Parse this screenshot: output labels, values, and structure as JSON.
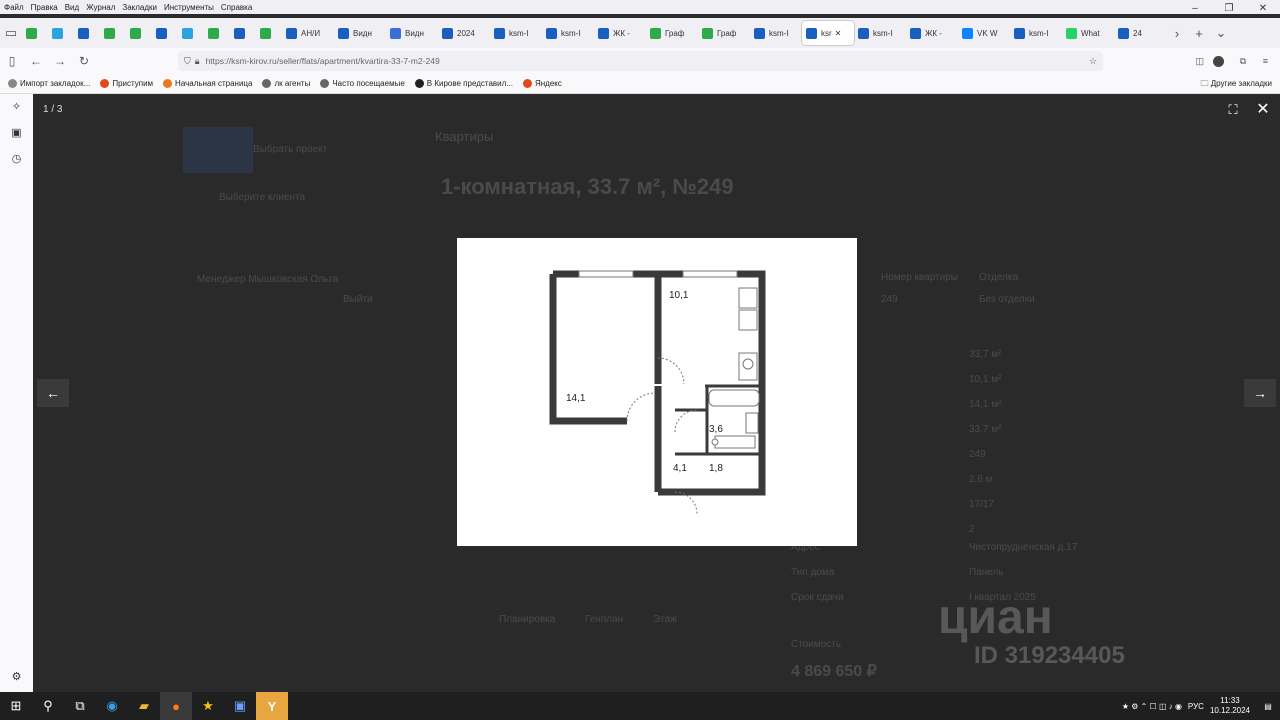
{
  "menu": [
    "Файл",
    "Правка",
    "Вид",
    "Журнал",
    "Закладки",
    "Инструменты",
    "Справка"
  ],
  "tabs": [
    {
      "label": "",
      "color": "#2eaa4a"
    },
    {
      "label": "",
      "color": "#2aa3e0"
    },
    {
      "label": "",
      "color": "#1a5fbf"
    },
    {
      "label": "",
      "color": "#2eaa4a"
    },
    {
      "label": "",
      "color": "#2eaa4a"
    },
    {
      "label": "",
      "color": "#1a5fbf"
    },
    {
      "label": "",
      "color": "#2aa3e0"
    },
    {
      "label": "",
      "color": "#2eaa4a"
    },
    {
      "label": "",
      "color": "#1a5fbf"
    },
    {
      "label": "",
      "color": "#2eaa4a"
    },
    {
      "label": "АН/И",
      "color": "#1a5fbf"
    },
    {
      "label": "Видн",
      "color": "#1a5fbf"
    },
    {
      "label": "Видн",
      "color": "#3b6fd6"
    },
    {
      "label": "2024",
      "color": "#1a5fbf"
    },
    {
      "label": "ksm-I",
      "color": "#1a5fbf"
    },
    {
      "label": "ksm-I",
      "color": "#1a5fbf"
    },
    {
      "label": "ЖК -",
      "color": "#1a5fbf"
    },
    {
      "label": "Граф",
      "color": "#2eaa4a"
    },
    {
      "label": "Граф",
      "color": "#2eaa4a"
    },
    {
      "label": "ksm-I",
      "color": "#1a5fbf"
    },
    {
      "label": "ksr",
      "color": "#1a5fbf",
      "active": true
    },
    {
      "label": "ksm-I",
      "color": "#1a5fbf"
    },
    {
      "label": "ЖК -",
      "color": "#1a5fbf"
    },
    {
      "label": "VK W",
      "color": "#0a84ff"
    },
    {
      "label": "ksm-I",
      "color": "#1a5fbf"
    },
    {
      "label": "What",
      "color": "#25d366"
    },
    {
      "label": "24",
      "color": "#1a5fbf"
    }
  ],
  "url": "https://ksm-kirov.ru/seller/flats/apartment/kvartira-33-7-m2-249",
  "bookmarks": [
    "Импорт закладок...",
    "Приступим",
    "Начальная страница",
    "лк агенты",
    "Часто посещаемые",
    "В Кирове представил...",
    "Яндекс"
  ],
  "other_bookmarks": "Другие закладки",
  "viewer": {
    "counter": "1 / 3"
  },
  "page": {
    "back": "Квартиры",
    "title": "1-комнатная, 33.7 м², №249",
    "project": "Выбрать проект",
    "client": "Выберите клиента",
    "manager": "Менеджер Мышковская Ольга",
    "logout": "Выйти",
    "head_num": "Номер квартиры",
    "head_fin": "Отделка",
    "num": "249",
    "fin": "Без отделки",
    "vals": [
      "33,7 м²",
      "10,1 м²",
      "14,1 м²",
      "33,7 м²",
      "249",
      "2,6 м",
      "17/17",
      "2"
    ],
    "label_address": "Адрес",
    "address": "Чистопрудненская д.17",
    "label_type": "Тип дома",
    "type": "Панель",
    "label_deadline": "Срок сдачи",
    "deadline": "I квартал 2025",
    "tabs": [
      "Планировка",
      "Генплан",
      "Этаж"
    ],
    "label_price": "Стоимость",
    "price": "4 869 650 ₽"
  },
  "plan": {
    "kitchen": "10,1",
    "room": "14,1",
    "bath": "3,6",
    "hall": "4,1",
    "wc": "1,8"
  },
  "watermark": {
    "brand": "циан",
    "id": "ID 319234405"
  },
  "taskbar": {
    "lang": "РУС",
    "time": "11:33",
    "date": "10.12.2024"
  }
}
